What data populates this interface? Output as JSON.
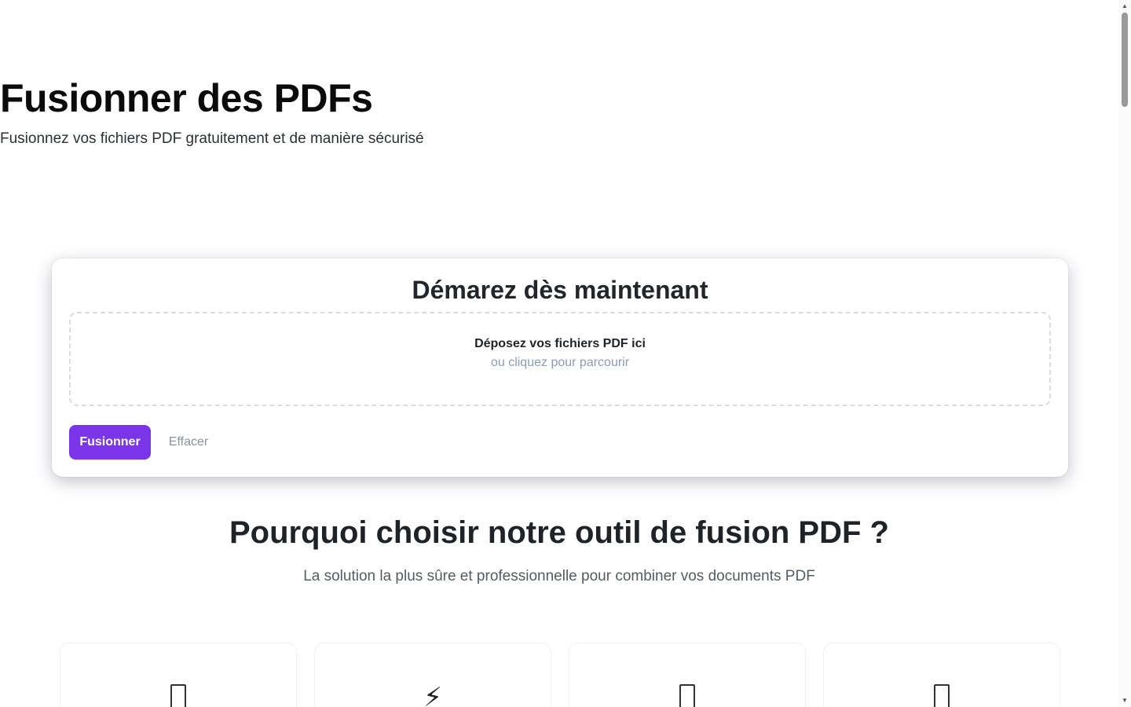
{
  "hero": {
    "title": "Fusionner des PDFs",
    "subtitle": "Fusionnez vos fichiers PDF gratuitement et de manière sécurisé"
  },
  "upload_card": {
    "title": "Démarez dès maintenant",
    "dropzone_main": "Déposez vos fichiers PDF ici",
    "dropzone_sub": "ou cliquez pour parcourir",
    "merge_label": "Fusionner",
    "clear_label": "Effacer"
  },
  "why": {
    "title": "Pourquoi choisir notre outil de fusion PDF ?",
    "subtitle": "La solution la plus sûre et professionnelle pour combiner vos documents PDF"
  },
  "features": [
    {
      "icon": "missing-glyph-icon"
    },
    {
      "icon": "lightning-icon",
      "glyph": "⚡"
    },
    {
      "icon": "missing-glyph-icon"
    },
    {
      "icon": "missing-glyph-icon"
    }
  ],
  "colors": {
    "accent": "#7b35e8",
    "muted_link": "#8a9cb5"
  }
}
